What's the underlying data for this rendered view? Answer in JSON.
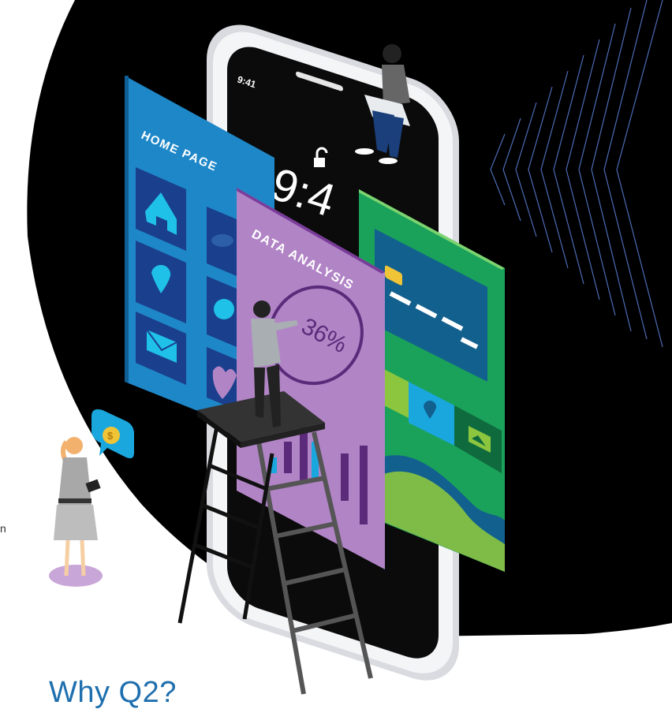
{
  "phone": {
    "status_time": "9:41",
    "lock_time": "9:4"
  },
  "screens": {
    "home": {
      "title": "HOME PAGE"
    },
    "analysis": {
      "title": "DATA ANALYSIS",
      "percent": "36%"
    }
  },
  "coin_bubble": {
    "symbol": "$"
  },
  "partial_text": "n",
  "heading": "Why Q2?",
  "colors": {
    "background_blob": "#000000",
    "home_screen": "#1e87c8",
    "analysis_screen": "#b184c6",
    "card_screen": "#1aa25a",
    "heading": "#1f6fae"
  },
  "icons": [
    "home-icon",
    "car-icon",
    "location-pin-icon",
    "play-icon",
    "mail-icon",
    "heart-icon",
    "credit-card-icon",
    "image-icon",
    "dollar-coin-icon"
  ]
}
